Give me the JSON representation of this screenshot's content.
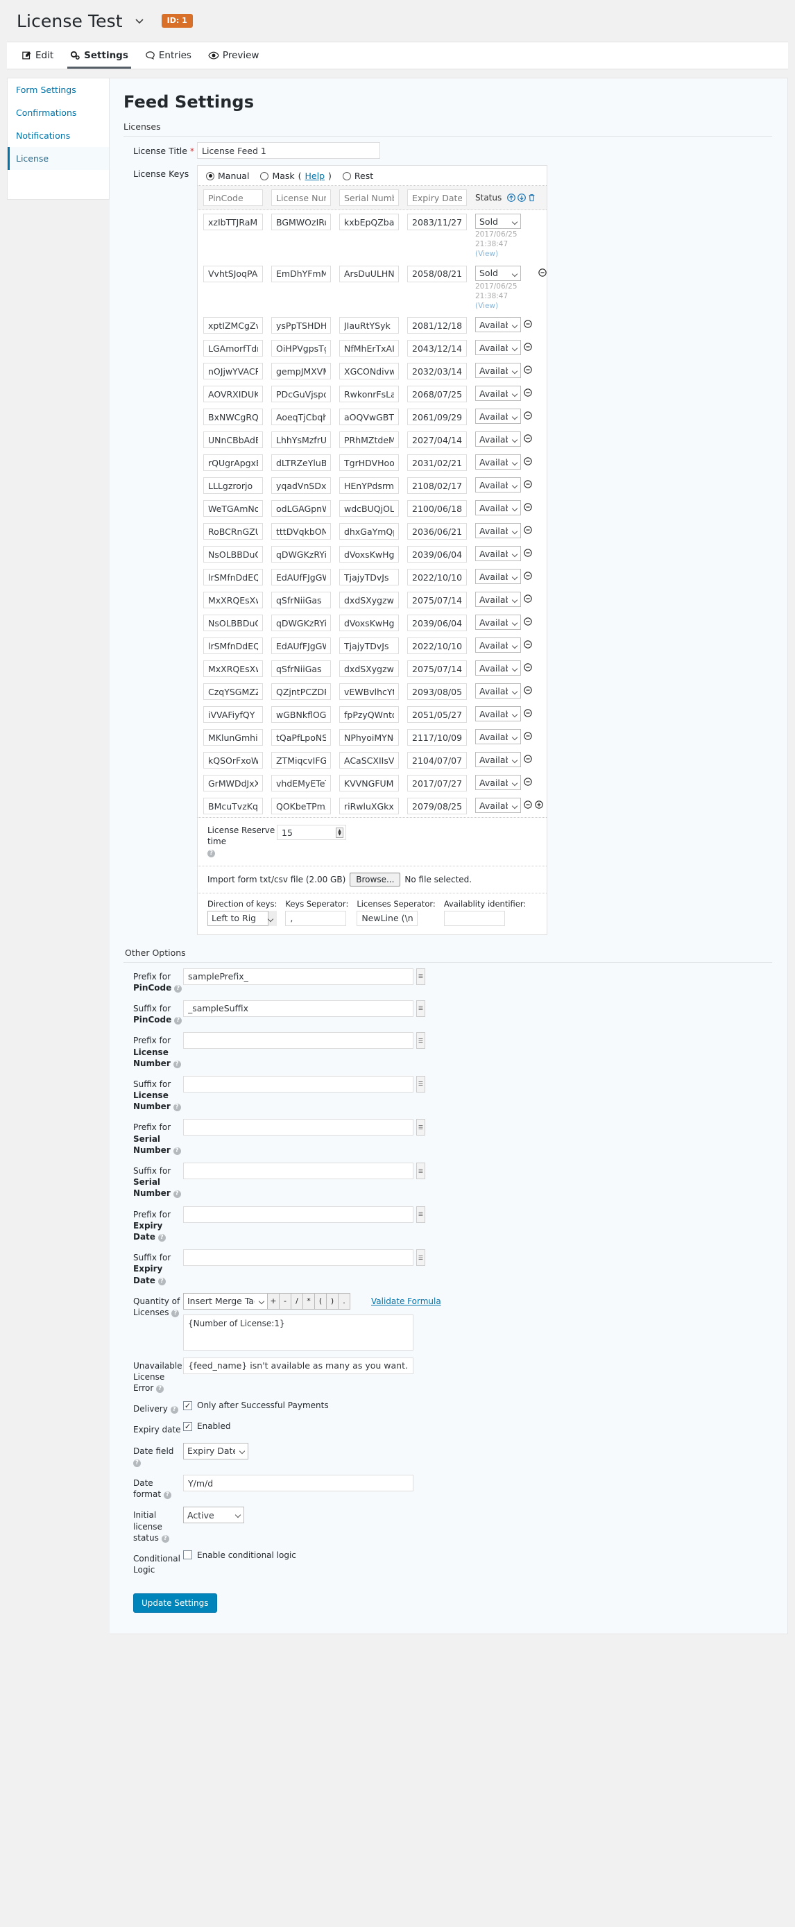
{
  "topbar": {
    "form_title": "License Test",
    "dropdown_icon": "chevron-down-icon",
    "id_badge": "ID: 1"
  },
  "tabs": [
    {
      "label": "Edit",
      "icon": "edit-pencil-icon",
      "active": false
    },
    {
      "label": "Settings",
      "icon": "gears-icon",
      "active": true
    },
    {
      "label": "Entries",
      "icon": "speech-bubble-icon",
      "active": false
    },
    {
      "label": "Preview",
      "icon": "eye-icon",
      "active": false
    }
  ],
  "sidebar": {
    "items": [
      {
        "label": "Form Settings",
        "active": false
      },
      {
        "label": "Confirmations",
        "active": false
      },
      {
        "label": "Notifications",
        "active": false
      },
      {
        "label": "License",
        "active": true
      }
    ]
  },
  "page": {
    "title": "Feed Settings",
    "licenses_section_label": "Licenses",
    "other_options_label": "Other Options"
  },
  "license_title": {
    "label": "License Title",
    "required_mark": "*",
    "value": "License Feed 1"
  },
  "license_keys": {
    "label": "License Keys",
    "modes": [
      {
        "label": "Manual",
        "selected": true
      },
      {
        "label": "Mask",
        "selected": false,
        "help": "Help"
      },
      {
        "label": "Rest",
        "selected": false
      }
    ],
    "columns": [
      "PinCode",
      "License Number",
      "Serial Number",
      "Expiry Date"
    ],
    "status_header": "Status",
    "header_icons": [
      "arrow-up-circle-icon",
      "arrow-down-circle-icon",
      "trash-icon"
    ],
    "rows": [
      {
        "pincode": "xzIbTTJRaM",
        "license_number": "BGMWOzIRuv",
        "serial_number": "kxbEpQZbaz",
        "expiry": "2083/11/27",
        "status": "Sold",
        "sold_at": "2017/06/25 21:38:47",
        "view": "(View)",
        "remove": false
      },
      {
        "pincode": "VvhtSJoqPA",
        "license_number": "EmDhYFmMfw",
        "serial_number": "ArsDuULHNu",
        "expiry": "2058/08/21",
        "status": "Sold",
        "sold_at": "2017/06/25 21:38:47",
        "view": "(View)",
        "remove": true
      },
      {
        "pincode": "xptIZMCgZv",
        "license_number": "ysPpTSHDHu",
        "serial_number": "JIauRtYSyk",
        "expiry": "2081/12/18",
        "status": "Available",
        "remove": true
      },
      {
        "pincode": "LGAmorfTdm",
        "license_number": "OiHPVgpsTg",
        "serial_number": "NfMhErTxAI",
        "expiry": "2043/12/14",
        "status": "Available",
        "remove": true
      },
      {
        "pincode": "nOJjwYVACR",
        "license_number": "gempJMXVMU",
        "serial_number": "XGCONdivwF",
        "expiry": "2032/03/14",
        "status": "Available",
        "remove": true
      },
      {
        "pincode": "AOVRXIDUKr",
        "license_number": "PDcGuVjspd",
        "serial_number": "RwkonrFsLa",
        "expiry": "2068/07/25",
        "status": "Available",
        "remove": true
      },
      {
        "pincode": "BxNWCgRQvG",
        "license_number": "AoeqTjCbqh",
        "serial_number": "aOQVwGBTIq",
        "expiry": "2061/09/29",
        "status": "Available",
        "remove": true
      },
      {
        "pincode": "UNnCBbAdEP",
        "license_number": "LhhYsMzfrU",
        "serial_number": "PRhMZtdeMv",
        "expiry": "2027/04/14",
        "status": "Available",
        "remove": true
      },
      {
        "pincode": "rQUgrApgxB",
        "license_number": "dLTRZeYluB",
        "serial_number": "TgrHDVHooX",
        "expiry": "2031/02/21",
        "status": "Available",
        "remove": true
      },
      {
        "pincode": "LLLgzrorjo",
        "license_number": "yqadVnSDxn",
        "serial_number": "HEnYPdsrmw",
        "expiry": "2108/02/17",
        "status": "Available",
        "remove": true
      },
      {
        "pincode": "WeTGAmNoFZ",
        "license_number": "odLGAGpnWp",
        "serial_number": "wdcBUQjOLk",
        "expiry": "2100/06/18",
        "status": "Available",
        "remove": true
      },
      {
        "pincode": "RoBCRnGZUL",
        "license_number": "tttDVqkbOM",
        "serial_number": "dhxGaYmQpV",
        "expiry": "2036/06/21",
        "status": "Available",
        "remove": true
      },
      {
        "pincode": "NsOLBBDuQS",
        "license_number": "qDWGKzRYiJ",
        "serial_number": "dVoxsKwHgP",
        "expiry": "2039/06/04",
        "status": "Available",
        "remove": true
      },
      {
        "pincode": "lrSMfnDdEQ",
        "license_number": "EdAUfFJgGW",
        "serial_number": "TjajyTDvJs",
        "expiry": "2022/10/10",
        "status": "Available",
        "remove": true
      },
      {
        "pincode": "MxXRQEsXwF",
        "license_number": "qSfrNiiGas",
        "serial_number": "dxdSXygzwr",
        "expiry": "2075/07/14",
        "status": "Available",
        "remove": true
      },
      {
        "pincode": "NsOLBBDuQS",
        "license_number": "qDWGKzRYiJ",
        "serial_number": "dVoxsKwHgP",
        "expiry": "2039/06/04",
        "status": "Available",
        "remove": true
      },
      {
        "pincode": "lrSMfnDdEQ",
        "license_number": "EdAUfFJgGW",
        "serial_number": "TjajyTDvJs",
        "expiry": "2022/10/10",
        "status": "Available",
        "remove": true
      },
      {
        "pincode": "MxXRQEsXwF",
        "license_number": "qSfrNiiGas",
        "serial_number": "dxdSXygzwr",
        "expiry": "2075/07/14",
        "status": "Available",
        "remove": true
      },
      {
        "pincode": "CzqYSGMZZI",
        "license_number": "QZjntPCZDP",
        "serial_number": "vEWBvlhcYt",
        "expiry": "2093/08/05",
        "status": "Available",
        "remove": true
      },
      {
        "pincode": "iVVAFiyfQY",
        "license_number": "wGBNkflOGB",
        "serial_number": "fpPzyQWnto",
        "expiry": "2051/05/27",
        "status": "Available",
        "remove": true
      },
      {
        "pincode": "MKlunGmhiw",
        "license_number": "tQaPfLpoNS",
        "serial_number": "NPhyoiMYNg",
        "expiry": "2117/10/09",
        "status": "Available",
        "remove": true
      },
      {
        "pincode": "kQSOrFxoWW",
        "license_number": "ZTMiqcvIFG",
        "serial_number": "ACaSCXIIsV",
        "expiry": "2104/07/07",
        "status": "Available",
        "remove": true
      },
      {
        "pincode": "GrMWDdJxXC",
        "license_number": "vhdEMyETeT",
        "serial_number": "KVVNGFUMwj",
        "expiry": "2017/07/27",
        "status": "Available",
        "remove": true
      },
      {
        "pincode": "BMcuTvzKqS",
        "license_number": "QOKbeTPmXO",
        "serial_number": "riRwluXGkx",
        "expiry": "2079/08/25",
        "status": "Available",
        "remove": true,
        "add": true
      }
    ],
    "status_options": [
      "Available",
      "Sold"
    ],
    "reserve": {
      "label": "License Reserve time",
      "value": "15",
      "help_icon": "question-mark-icon"
    },
    "import": {
      "label": "Import form txt/csv file (2.00 GB)",
      "button": "Browse...",
      "status": "No file selected."
    },
    "direction": {
      "label": "Direction of keys:",
      "value": "Left to Right"
    },
    "keys_separator": {
      "label": "Keys Seperator:",
      "value": ","
    },
    "licenses_separator": {
      "label": "Licenses Seperator:",
      "value": "NewLine (\\n)"
    },
    "availability_identifier": {
      "label": "Availablity identifier:",
      "value": ""
    }
  },
  "other_options": {
    "prefix_pincode": {
      "label_pre": "Prefix for ",
      "label_bold": "PinCode",
      "value": "samplePrefix_"
    },
    "suffix_pincode": {
      "label_pre": "Suffix for ",
      "label_bold": "PinCode",
      "value": "_sampleSuffix"
    },
    "prefix_license_number": {
      "label_pre": "Prefix for ",
      "label_bold": "License Number",
      "value": ""
    },
    "suffix_license_number": {
      "label_pre": "Suffix for ",
      "label_bold": "License Number",
      "value": ""
    },
    "prefix_serial_number": {
      "label_pre": "Prefix for ",
      "label_bold": "Serial Number",
      "value": ""
    },
    "suffix_serial_number": {
      "label_pre": "Suffix for ",
      "label_bold": "Serial Number",
      "value": ""
    },
    "prefix_expiry_date": {
      "label_pre": "Prefix for ",
      "label_bold": "Expiry Date",
      "value": ""
    },
    "suffix_expiry_date": {
      "label_pre": "Suffix for ",
      "label_bold": "Expiry Date",
      "value": ""
    },
    "quantity": {
      "label": "Quantity of Licenses",
      "merge_tag": "Insert Merge Tag",
      "operators": [
        "+",
        "-",
        "/",
        "*",
        "(",
        ")",
        "."
      ],
      "validate_link": "Validate Formula",
      "formula": "{Number of License:1}"
    },
    "unavailable_error": {
      "label": "Unavailable License Error",
      "value": "{feed_name} isn't available as many as you want. the number of remains: {remains}"
    },
    "delivery": {
      "label": "Delivery",
      "checkbox_label": "Only after Successful Payments",
      "checked": true
    },
    "expiry_date": {
      "label": "Expiry date",
      "checkbox_label": "Enabled",
      "checked": true
    },
    "date_field": {
      "label": "Date field",
      "value": "Expiry Date"
    },
    "date_format": {
      "label": "Date format",
      "value": "Y/m/d"
    },
    "initial_status": {
      "label": "Initial license status",
      "value": "Active"
    },
    "conditional_logic": {
      "label": "Conditional Logic",
      "checkbox_label": "Enable conditional logic",
      "checked": false
    },
    "update_button": "Update Settings"
  },
  "colors": {
    "accent": "#0073aa",
    "badge": "#d9702a",
    "button": "#0085ba",
    "required": "#d63638"
  }
}
